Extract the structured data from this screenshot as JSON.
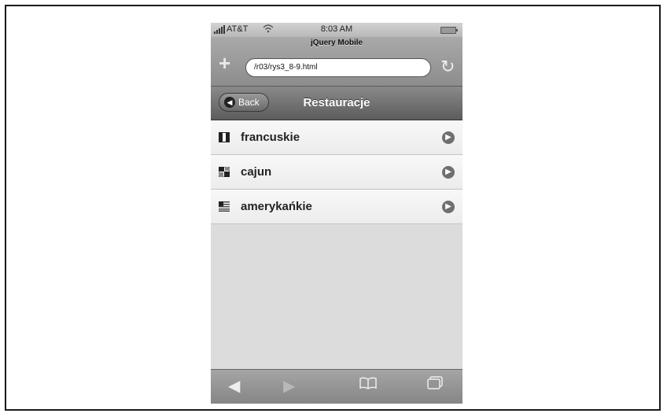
{
  "status_bar": {
    "carrier": "AT&T",
    "time": "8:03 AM",
    "signal_icon": "signal-bars-icon",
    "wifi_icon": "wifi-icon",
    "battery_icon": "battery-icon"
  },
  "browser": {
    "page_title": "jQuery Mobile",
    "url": "/r03/rys3_8-9.html",
    "add_icon": "plus-icon",
    "reload_icon": "reload-icon"
  },
  "header": {
    "back_label": "Back",
    "title": "Restauracje"
  },
  "list": {
    "items": [
      {
        "label": "francuskie",
        "icon": "flag-france-icon"
      },
      {
        "label": "cajun",
        "icon": "flag-cajun-icon"
      },
      {
        "label": "amerykańkie",
        "icon": "flag-usa-icon"
      }
    ]
  },
  "toolbar": {
    "back": "◀",
    "forward": "▶",
    "bookmarks": "🕮",
    "pages": "⧉"
  },
  "colors": {
    "header": "#6e6e6e",
    "list_bg": "#f2f2f2",
    "page_bg": "#dcdcdc"
  }
}
